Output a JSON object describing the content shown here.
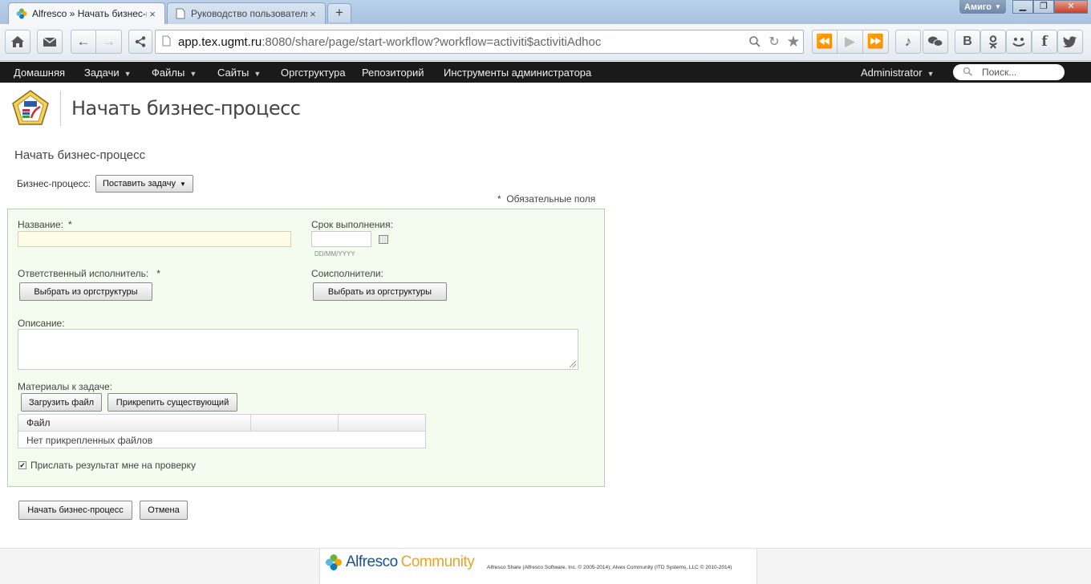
{
  "browser": {
    "tabs": [
      {
        "title": "Alfresco » Начать бизнес-п",
        "icon": "alfresco-favicon",
        "active": true
      },
      {
        "title": "Руководство пользователя",
        "icon": "document-icon",
        "active": false
      }
    ],
    "new_tab_label": "+",
    "profile_name": "Амиго",
    "url_host": "app.tex.ugmt.ru",
    "url_rest": ":8080/share/page/start-workflow?workflow=activiti$activitiAdhoc"
  },
  "nav": {
    "items": [
      {
        "label": "Домашняя",
        "caret": false
      },
      {
        "label": "Задачи",
        "caret": true
      },
      {
        "label": "Файлы",
        "caret": true
      },
      {
        "label": "Сайты",
        "caret": true
      },
      {
        "label": "Оргструктура",
        "caret": false
      },
      {
        "label": "Репозиторий",
        "caret": false
      },
      {
        "label": "Инструменты администратора",
        "caret": false
      }
    ],
    "user": "Administrator",
    "search_placeholder": "Поиск..."
  },
  "brand": {
    "title": "Начать бизнес-процесс"
  },
  "form": {
    "heading": "Начать бизнес-процесс",
    "workflow_label": "Бизнес-процесс:",
    "workflow_selected": "Поставить задачу",
    "required_note": "Обязательные поля",
    "required_mark": "*",
    "name_label": "Название:",
    "name_value": "",
    "due_label": "Срок выполнения:",
    "due_value": "",
    "due_hint": "DD/MM/YYYY",
    "assignee_label": "Ответственный исполнитель:",
    "assignee_button": "Выбрать из оргструктуры",
    "coexecutors_label": "Соисполнители:",
    "coexecutors_button": "Выбрать из оргструктуры",
    "description_label": "Описание:",
    "description_value": "",
    "materials_label": "Материалы к задаче:",
    "upload_button": "Загрузить файл",
    "attach_button": "Прикрепить существующий",
    "files_table": {
      "columns": [
        "Файл",
        "",
        ""
      ],
      "empty_message": "Нет прикрепленных файлов"
    },
    "review_checkbox_label": "Прислать результат мне на проверку",
    "review_checked": true,
    "submit_button": "Начать бизнес-процесс",
    "cancel_button": "Отмена"
  },
  "footer": {
    "logo_part1": "Alfresco",
    "logo_part2": "Community",
    "copyright": "Alfresco Share (Alfresco Software, Inc. © 2005-2014); Alvex Community (ITD Systems, LLC © 2010-2014)"
  },
  "colors": {
    "nav_bg": "#1a1a1a",
    "form_panel_bg": "#f3fcef",
    "mandatory_field_bg": "#fefbe6",
    "footer_logo_blue": "#1a4f8b",
    "footer_logo_orange": "#e8a32b"
  }
}
